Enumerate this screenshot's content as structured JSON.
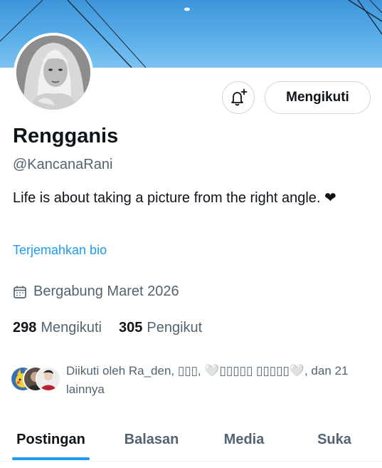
{
  "banner": {
    "image": "blue-sky-power-lines"
  },
  "profile": {
    "avatar": "woman-portrait-grayscale",
    "display_name": "Rengganis",
    "handle": "@KancanaRani",
    "bio": "Life is about taking a picture from the right angle. ❤",
    "translate_label": "Terjemahkan bio",
    "joined_icon": "calendar-icon",
    "joined_text": "Bergabung Maret 2026"
  },
  "actions": {
    "notify_icon": "bell-plus-icon",
    "follow_label": "Mengikuti"
  },
  "stats": {
    "following_count": "298",
    "following_label": "Mengikuti",
    "followers_count": "305",
    "followers_label": "Pengikut"
  },
  "followed_by": {
    "text": "Diikuti oleh Ra_den, ▯▯▯, 🤍▯▯▯▯▯ ▯▯▯▯▯🤍, dan 21 lainnya"
  },
  "tabs": [
    {
      "label": "Postingan",
      "active": true
    },
    {
      "label": "Balasan",
      "active": false
    },
    {
      "label": "Media",
      "active": false
    },
    {
      "label": "Suka",
      "active": false
    }
  ],
  "colors": {
    "accent": "#1d9bf0",
    "text": "#0f1419",
    "secondary": "#536471",
    "border": "#cfd9de"
  }
}
